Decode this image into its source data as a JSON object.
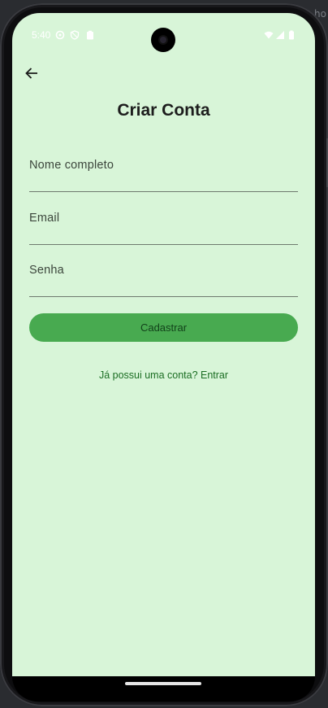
{
  "background": {
    "partial_text": "-ho"
  },
  "status_bar": {
    "time": "5:40",
    "left_icons": [
      "settings-icon",
      "shield-icon",
      "clipboard-icon"
    ],
    "right_icons": [
      "wifi-icon",
      "signal-icon",
      "battery-icon"
    ]
  },
  "header": {
    "back_icon": "arrow-left-icon",
    "title": "Criar Conta"
  },
  "form": {
    "fields": [
      {
        "label": "Nome completo",
        "value": ""
      },
      {
        "label": "Email",
        "value": ""
      },
      {
        "label": "Senha",
        "value": ""
      }
    ],
    "submit_label": "Cadastrar",
    "login_link": "Já possui uma conta? Entrar"
  },
  "colors": {
    "screen_background": "#d8f5d8",
    "button": "#48aa50",
    "link": "#1b6e23"
  }
}
